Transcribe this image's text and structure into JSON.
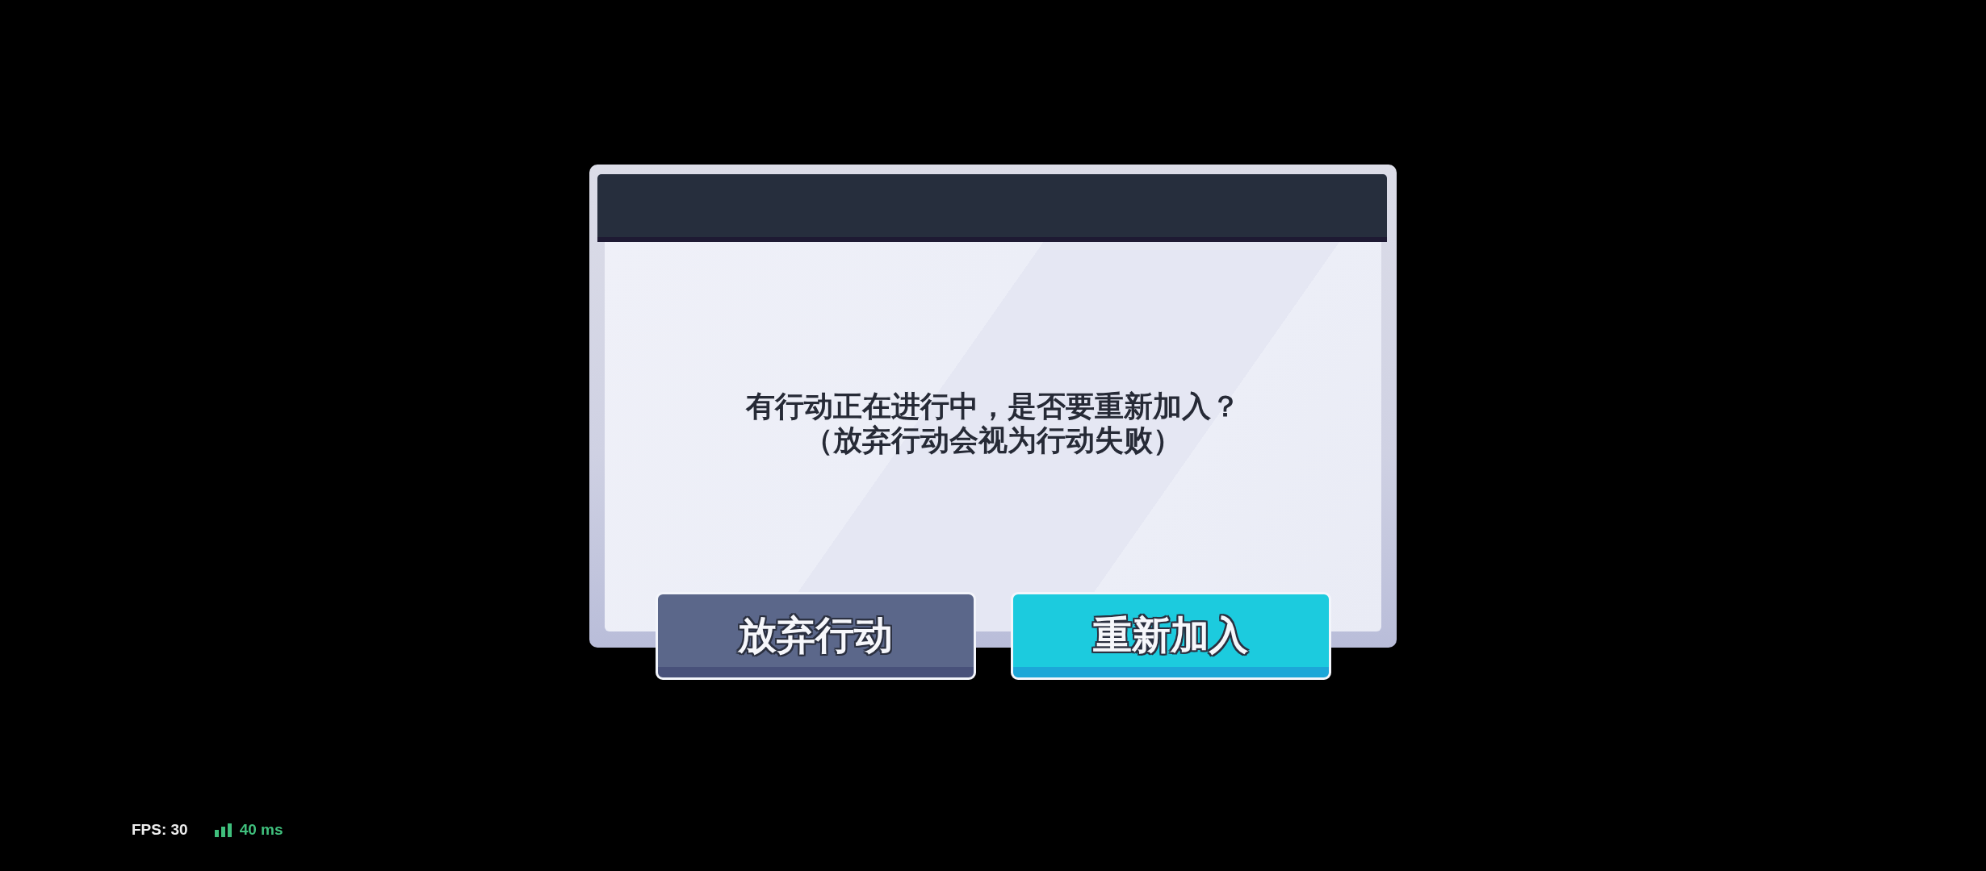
{
  "dialog": {
    "message_lines": [
      "有行动正在进行中，是否要重新加入？",
      "（放弃行动会视为行动失败）"
    ],
    "buttons": [
      {
        "label": "放弃行动",
        "kind": "secondary"
      },
      {
        "label": "重新加入",
        "kind": "primary"
      }
    ]
  },
  "hud": {
    "fps": "FPS: 30",
    "ping": "40 ms"
  }
}
